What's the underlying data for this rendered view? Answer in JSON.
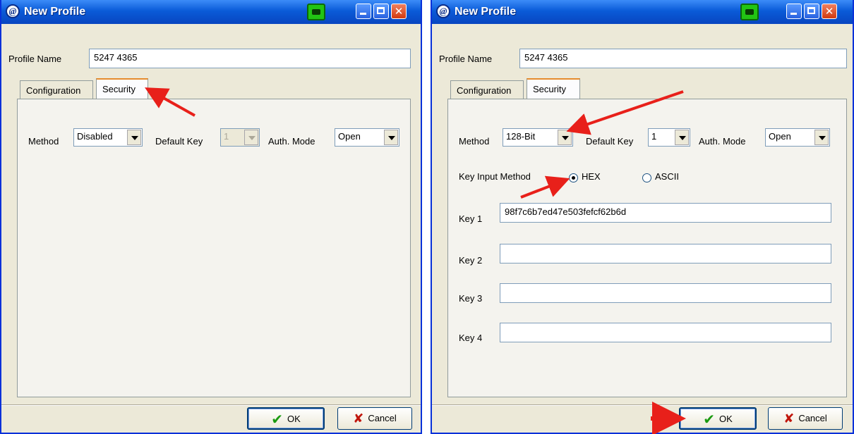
{
  "left_dialog": {
    "title": "New Profile",
    "profile_name_label": "Profile Name",
    "profile_name_value": "5247 4365",
    "tabs": [
      {
        "label": "Configuration"
      },
      {
        "label": "Security"
      }
    ],
    "active_tab": "Security",
    "method_label": "Method",
    "method_value": "Disabled",
    "default_key_label": "Default Key",
    "default_key_value": "1",
    "auth_mode_label": "Auth. Mode",
    "auth_mode_value": "Open",
    "ok_label": "OK",
    "cancel_label": "Cancel"
  },
  "right_dialog": {
    "title": "New Profile",
    "profile_name_label": "Profile Name",
    "profile_name_value": "5247 4365",
    "tabs": [
      {
        "label": "Configuration"
      },
      {
        "label": "Security"
      }
    ],
    "active_tab": "Security",
    "method_label": "Method",
    "method_value": "128-Bit",
    "default_key_label": "Default Key",
    "default_key_value": "1",
    "auth_mode_label": "Auth. Mode",
    "auth_mode_value": "Open",
    "key_input_method_label": "Key Input Method",
    "hex_label": "HEX",
    "ascii_label": "ASCII",
    "hex_selected": true,
    "keys": [
      {
        "label": "Key 1",
        "value": "98f7c6b7ed47e503fefcf62b6d"
      },
      {
        "label": "Key 2",
        "value": ""
      },
      {
        "label": "Key 3",
        "value": ""
      },
      {
        "label": "Key 4",
        "value": ""
      }
    ],
    "ok_label": "OK",
    "cancel_label": "Cancel"
  },
  "icons": {
    "app": "app-logo-icon",
    "network": "network-icon",
    "minimize": "minimize-icon",
    "maximize": "maximize-icon",
    "close": "close-icon",
    "ok": "checkmark-icon",
    "cancel": "x-icon"
  },
  "colors": {
    "titlebar": "#0a5bd8",
    "dialog_bg": "#ece9d8",
    "annotation_arrow": "#e8201a"
  }
}
